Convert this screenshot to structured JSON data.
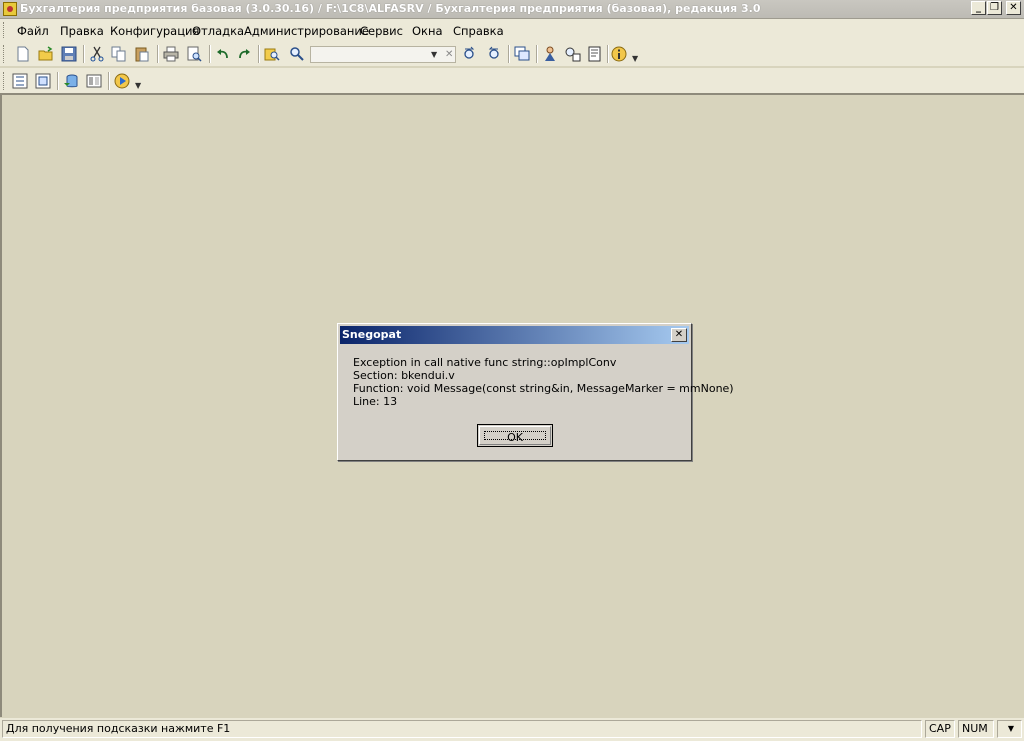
{
  "window": {
    "title": "Бухгалтерия предприятия базовая (3.0.30.16) / F:\\1C8\\ALFASRV / Бухгалтерия предприятия (базовая), редакция 3.0",
    "minimize": "_",
    "restore": "❐",
    "close": "✕"
  },
  "menu": {
    "file": "Файл",
    "edit": "Правка",
    "configuration": "Конфигурация",
    "debug": "Отладка",
    "administration": "Администрирование",
    "service": "Сервис",
    "windows": "Окна",
    "help": "Справка"
  },
  "toolbar": {
    "search_value": "",
    "clear_symbol": "✕",
    "dropdown_symbol": "▼"
  },
  "dialog": {
    "title": "Snegopat",
    "close": "✕",
    "lines": [
      "Exception in call native func string::opImplConv",
      "Section: bkendui.v",
      "Function: void Message(const string&in, MessageMarker = mmNone)",
      "Line: 13"
    ],
    "ok": "OK"
  },
  "status": {
    "hint": "Для получения подсказки нажмите F1",
    "cap": "CAP",
    "num": "NUM",
    "dropdown": "▼"
  },
  "colors": {
    "workspace": "#d8d4bd",
    "dialog_title_start": "#0a246a",
    "dialog_title_end": "#a6caf0",
    "chrome": "#ece9d8"
  }
}
